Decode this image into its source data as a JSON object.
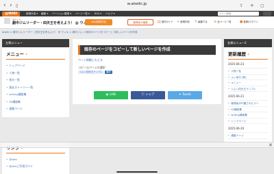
{
  "browser": {
    "url": "w.atwiki.jp"
  },
  "header": {
    "logo": "@WIKI",
    "nav": [
      "新規作成 ▾",
      "編集 ▾",
      "バージョン管理 ▾",
      "ページ一覧 ▾",
      "RSS ▾",
      "ヘルプ ▾"
    ],
    "search_placeholder": "ページ検索",
    "subtitle": "@ウィキ",
    "title": "劇中ジムリーダー・四天王を考えよう！ @ ウィキ",
    "wiki_create_button": "wiki新規作成",
    "edit_button": "管理者の編集",
    "links": [
      "操作ガイド",
      "新規作成",
      "編集する",
      "全ページ一覧",
      "登録/ログイン"
    ]
  },
  "breadcrumb": "atwiki > 劇中ジムリーダー・四天王を考えよう！ @ ウィキ > 劇中ジム > 既存のページをコピーして新しいページを作成",
  "sidebar_left": {
    "header": "左側メニュー",
    "menu_title": "メニュー",
    "items": [
      "トップページ",
      "人物一覧",
      "地方一覧",
      "過去ストーリー一覧",
      "writing講座集",
      "SS講座集",
      "連載ページ"
    ]
  },
  "links_panel": {
    "title": "リンク",
    "items": [
      "@wiki",
      "@wikiご利用ガイド"
    ]
  },
  "main": {
    "title": "既存のページをコピーして新しいページを作成",
    "back_link": "ページ移動にもどる",
    "copy_label": "コピー元ページの選択",
    "source_page": "ジムリ四天王テンプレ",
    "select_button": "選択",
    "share_line": "LINE",
    "share_facebook": "シェア",
    "share_twitter": "Tweet"
  },
  "sidebar_right": {
    "header": "右側メニュー2",
    "section_title": "更新履歴",
    "dates": [
      "2025-06-23",
      "2025-06-21",
      "2025-06-20"
    ],
    "group1": [
      "人物一覧",
      "ふぃ地方 (削)",
      "メニュー",
      "ジムリ四天王テンプレ"
    ],
    "group2": [
      "管理者が代筆された人へ",
      "SS講座集",
      "writing講座集",
      "トップページ"
    ],
    "group3": [
      "連載ページ"
    ]
  },
  "colors": {
    "accent": "#e8761d",
    "dark": "#3a3a3a",
    "link": "#3b6fb5"
  }
}
